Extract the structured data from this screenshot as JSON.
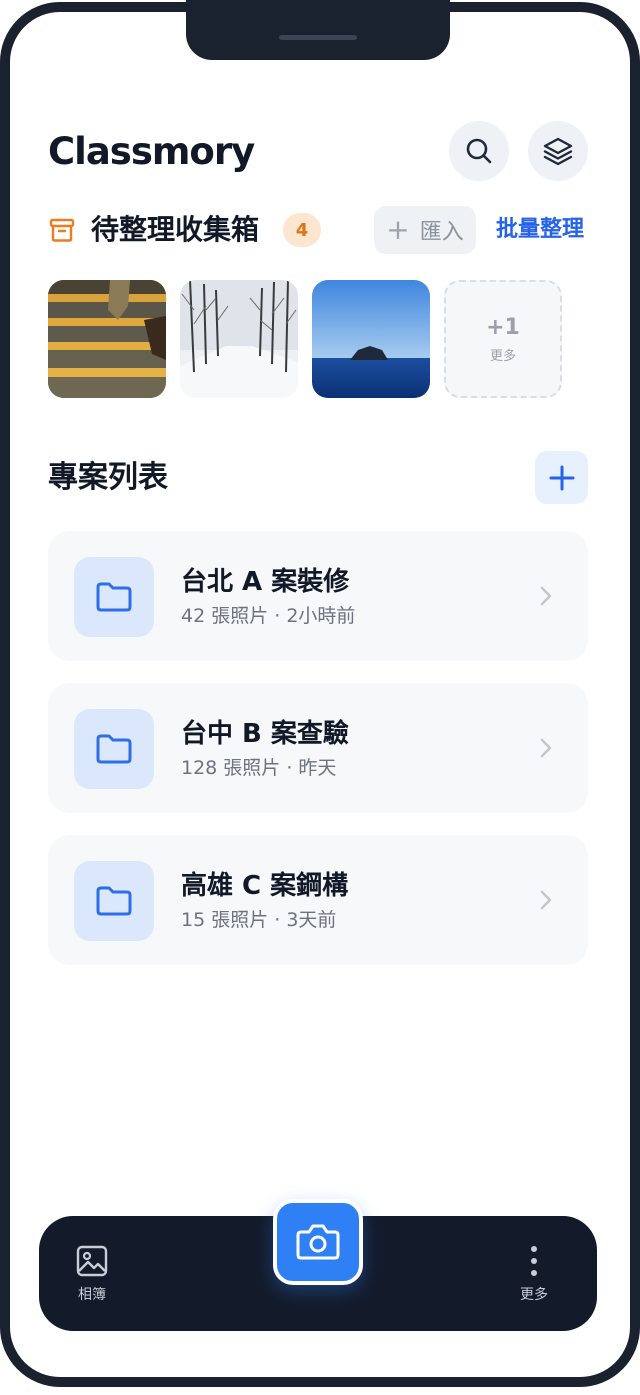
{
  "app": {
    "title": "Classmory"
  },
  "header": {
    "search_icon": "search-icon",
    "layers_icon": "layers-icon"
  },
  "inbox": {
    "title": "待整理收集箱",
    "count": "4",
    "import_label": "匯入",
    "batch_label": "批量整理",
    "thumbnails": [
      {
        "subject": "stairs-photo"
      },
      {
        "subject": "snowy-forest-photo"
      },
      {
        "subject": "sea-island-photo"
      }
    ],
    "more_count": "+1",
    "more_label": "更多"
  },
  "projects": {
    "title": "專案列表",
    "items": [
      {
        "name": "台北 A 案裝修",
        "meta": "42 張照片 · 2小時前"
      },
      {
        "name": "台中 B 案查驗",
        "meta": "128 張照片 · 昨天"
      },
      {
        "name": "高雄 C 案鋼構",
        "meta": "15 張照片 · 3天前"
      }
    ]
  },
  "bottom_nav": {
    "album_label": "相簿",
    "more_label": "更多",
    "camera_icon": "camera-icon"
  },
  "colors": {
    "accent": "#2563eb",
    "fab": "#2f7ff5",
    "inbox_icon": "#f07b1e",
    "badge_bg": "#fde6cf",
    "badge_text": "#e0741a",
    "nav_bg": "#131b2b",
    "frame": "#1a2230"
  }
}
